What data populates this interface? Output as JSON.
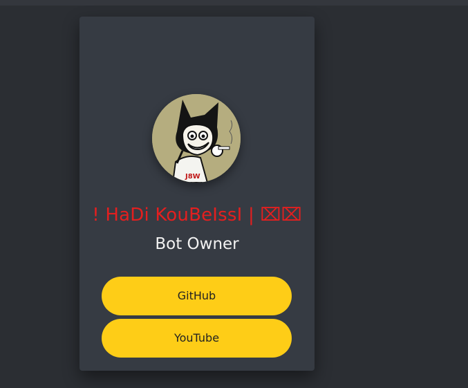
{
  "profile": {
    "display_name": "! HaDi KouBeIssI | ⌧⌧",
    "role": "Bot Owner",
    "avatar_icon": "cartoon-cat-boy-avatar"
  },
  "links": {
    "github_label": "GitHub",
    "youtube_label": "YouTube"
  },
  "colors": {
    "background": "#2b2e33",
    "card": "#363b43",
    "name": "#e41f1f",
    "button": "#fecd17"
  }
}
